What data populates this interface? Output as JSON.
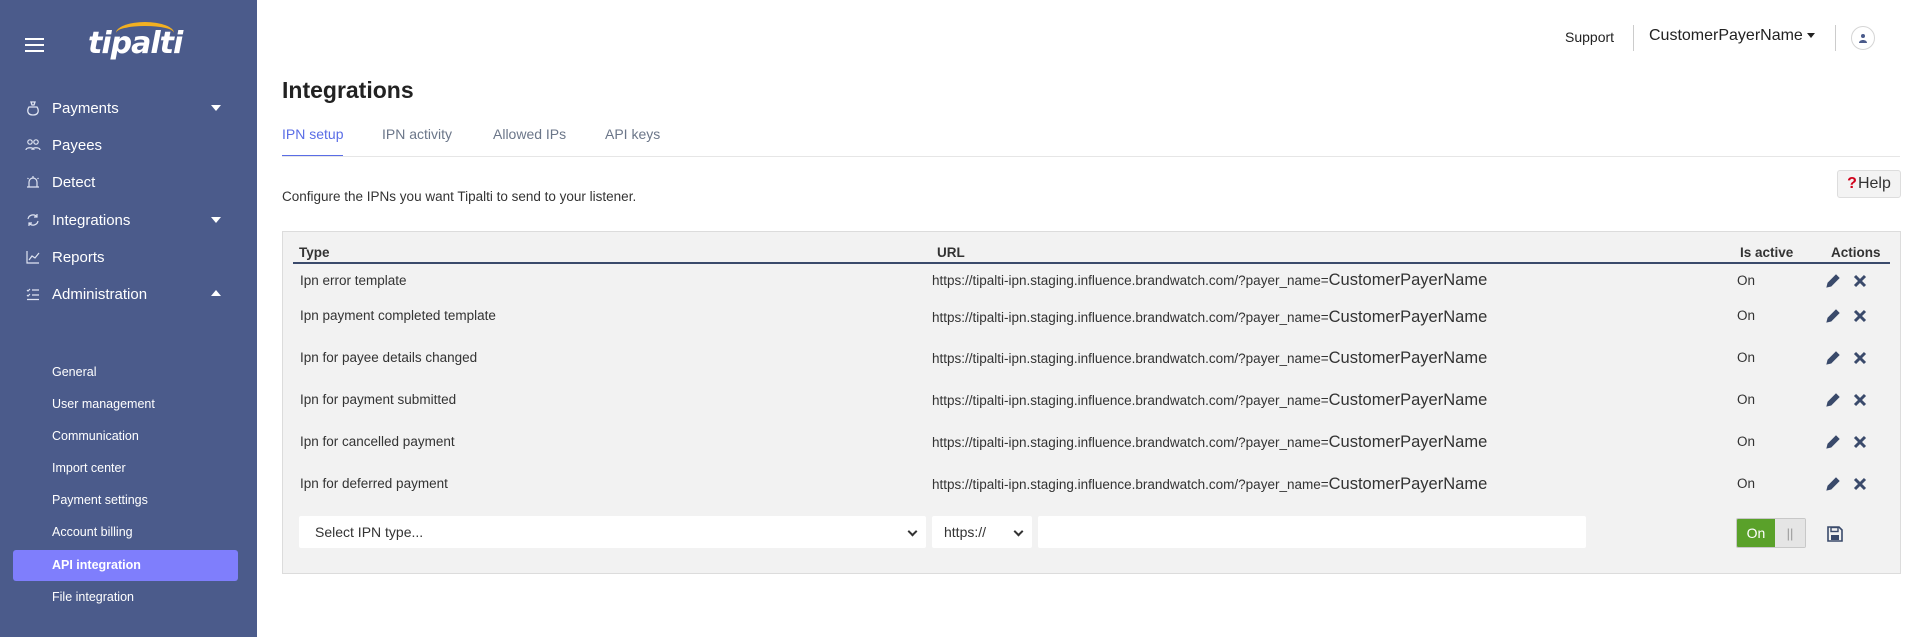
{
  "sidebar": {
    "logo": "tipalti",
    "items": [
      {
        "label": "Payments",
        "icon": "money-bag-icon"
      },
      {
        "label": "Payees",
        "icon": "people-icon"
      },
      {
        "label": "Detect",
        "icon": "alarm-icon"
      },
      {
        "label": "Integrations",
        "icon": "sync-icon"
      },
      {
        "label": "Reports",
        "icon": "chart-icon"
      },
      {
        "label": "Administration",
        "icon": "list-check-icon"
      }
    ],
    "admin_subitems": [
      {
        "label": "General"
      },
      {
        "label": "User management"
      },
      {
        "label": "Communication"
      },
      {
        "label": "Import center"
      },
      {
        "label": "Payment settings"
      },
      {
        "label": "Account billing"
      },
      {
        "label": "API integration"
      },
      {
        "label": "File integration"
      }
    ]
  },
  "header": {
    "support": "Support",
    "user": "CustomerPayerName"
  },
  "page": {
    "title": "Integrations",
    "tabs": [
      {
        "label": "IPN setup"
      },
      {
        "label": "IPN activity"
      },
      {
        "label": "Allowed IPs"
      },
      {
        "label": "API keys"
      }
    ],
    "help": "Help",
    "help_mark": "?",
    "description": "Configure the IPNs you want Tipalti to send to your listener."
  },
  "table": {
    "headers": {
      "type": "Type",
      "url": "URL",
      "active": "Is active",
      "actions": "Actions"
    },
    "rows": [
      {
        "type": "Ipn error template",
        "url_prefix": "https://tipalti-ipn.staging.influence.brandwatch.com/?payer_name=",
        "url_name": "CustomerPayerName",
        "active": "On"
      },
      {
        "type": "Ipn payment completed template",
        "url_prefix": "https://tipalti-ipn.staging.influence.brandwatch.com/?payer_name=",
        "url_name": "CustomerPayerName",
        "active": "On"
      },
      {
        "type": "Ipn for payee details changed",
        "url_prefix": "https://tipalti-ipn.staging.influence.brandwatch.com/?payer_name=",
        "url_name": "CustomerPayerName",
        "active": "On"
      },
      {
        "type": "Ipn for payment submitted",
        "url_prefix": "https://tipalti-ipn.staging.influence.brandwatch.com/?payer_name=",
        "url_name": "CustomerPayerName",
        "active": "On"
      },
      {
        "type": "Ipn for cancelled payment",
        "url_prefix": "https://tipalti-ipn.staging.influence.brandwatch.com/?payer_name=",
        "url_name": "CustomerPayerName",
        "active": "On"
      },
      {
        "type": "Ipn for deferred payment",
        "url_prefix": "https://tipalti-ipn.staging.influence.brandwatch.com/?payer_name=",
        "url_name": "CustomerPayerName",
        "active": "On"
      }
    ]
  },
  "new_row": {
    "type_select": "Select IPN type...",
    "protocol": "https://",
    "url_value": "",
    "toggle_on": "On",
    "toggle_off": "||"
  },
  "colors": {
    "sidebar_bg": "#4b5b8b",
    "active_item": "#7f7efc",
    "tab_accent": "#5a6de6",
    "toggle_green": "#5aa12a"
  }
}
